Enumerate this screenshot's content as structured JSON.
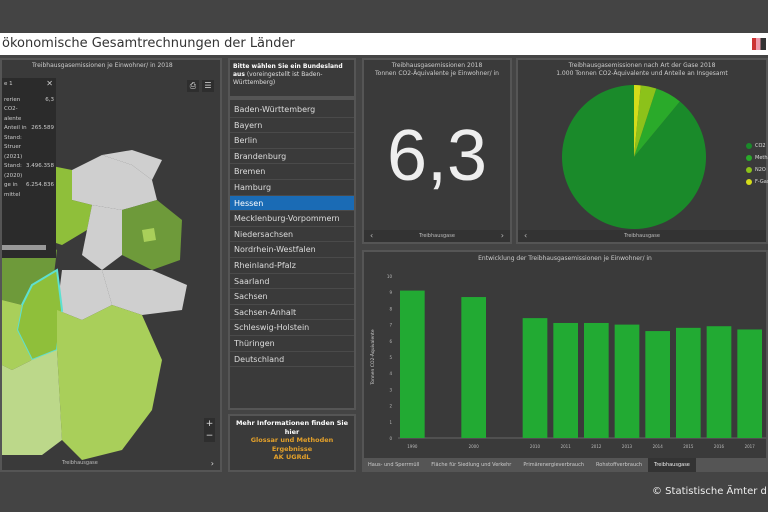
{
  "title": "ökonomische Gesamtrechnungen der Länder",
  "map": {
    "title": "Treibhausgasemissionen je Einwohner/ in 2018",
    "popup": {
      "header": "e 1",
      "rows": [
        [
          "rerien",
          "6,3"
        ],
        [
          "CO2-",
          ""
        ],
        [
          "alente",
          ""
        ],
        [
          "Anteil in",
          "265.589"
        ],
        [
          "Stand:",
          ""
        ],
        [
          "Struer",
          ""
        ],
        [
          "(2021)",
          ""
        ],
        [
          "Stand:",
          "3.496.358"
        ],
        [
          "(2020)",
          ""
        ],
        [
          "ge in",
          "6.254.836"
        ],
        [
          "mittel",
          ""
        ]
      ]
    },
    "footer": "Treibhausgase",
    "zoom_in": "+",
    "zoom_out": "−"
  },
  "prompt": {
    "bold": "Bitte wählen Sie ein Bundesland aus",
    "rest": " (voreingestellt ist Baden-Württemberg)"
  },
  "states": [
    "Baden-Württemberg",
    "Bayern",
    "Berlin",
    "Brandenburg",
    "Bremen",
    "Hamburg",
    "Hessen",
    "Mecklenburg-Vorpommern",
    "Niedersachsen",
    "Nordrhein-Westfalen",
    "Rheinland-Pfalz",
    "Saarland",
    "Sachsen",
    "Sachsen-Anhalt",
    "Schleswig-Holstein",
    "Thüringen",
    "Deutschland"
  ],
  "selected_state": "Hessen",
  "info": {
    "title": "Mehr Informationen finden Sie hier",
    "links": [
      "Glossar und Methoden",
      "Ergebnisse",
      "AK UGRdL"
    ]
  },
  "kpi": {
    "title1": "Treibhausgasemissionen 2018",
    "title2": "Tonnen CO2-Äquivalente je Einwohner/ in",
    "value": "6,3",
    "footer": "Treibhausgase"
  },
  "pie": {
    "title1": "Treibhausgasemissionen nach Art der Gase 2018",
    "title2": "1.000 Tonnen CO2-Äquivalente und Anteile an Insgesamt",
    "footer": "Treibhausgase",
    "legend": [
      "CO2",
      "Methan",
      "N2O",
      "F-Gase"
    ],
    "shares": [
      89,
      6,
      3.5,
      1.5
    ],
    "colors": [
      "#1a8a2a",
      "#2aaa2a",
      "#8cc21a",
      "#d4dc1a"
    ]
  },
  "chart_data": {
    "type": "bar",
    "title": "Entwicklung der Treibhausgasemissionen je Einwohner/ in",
    "ylabel": "Tonnen CO2-Äquivalente",
    "ylim": [
      0,
      10
    ],
    "yticks": [
      0,
      1,
      2,
      3,
      4,
      5,
      6,
      7,
      8,
      9,
      10
    ],
    "categories": [
      "1990",
      "",
      "2000",
      "",
      "2010",
      "2011",
      "2012",
      "2013",
      "2014",
      "2015",
      "2016",
      "2017"
    ],
    "values": [
      9.1,
      null,
      8.7,
      null,
      7.4,
      7.1,
      7.1,
      7.0,
      6.6,
      6.8,
      6.9,
      6.7
    ],
    "color": "#22aa33"
  },
  "tabs": [
    "Haus- und Sperrmüll",
    "Fläche für Siedlung und Verkehr",
    "Primärenergieverbrauch",
    "Rohstoffverbrauch",
    "Treibhausgase"
  ],
  "active_tab": "Treibhausgase",
  "copyright": "© Statistische Ämter d"
}
